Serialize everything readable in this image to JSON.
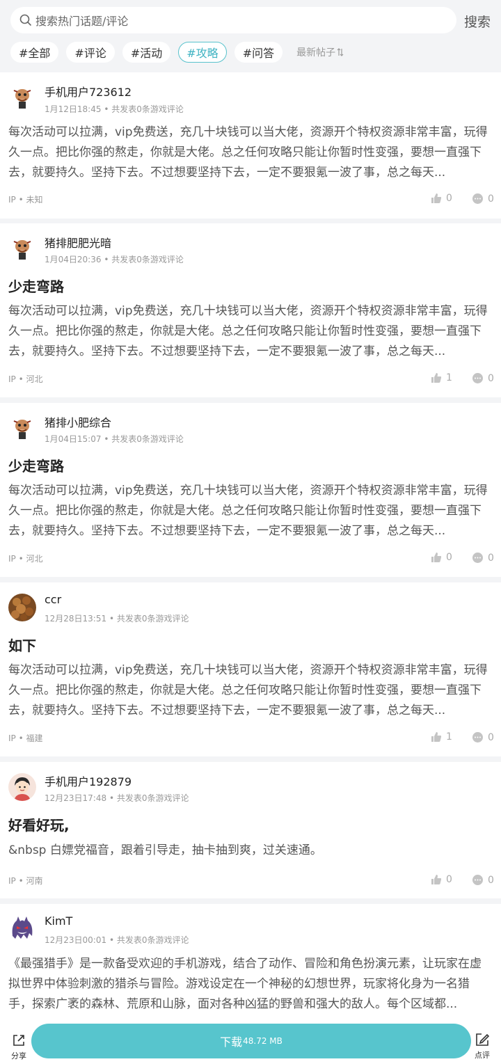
{
  "search": {
    "placeholder": "搜索热门话题/评论",
    "button": "搜索"
  },
  "tabs": [
    {
      "label": "#全部",
      "active": false
    },
    {
      "label": "#评论",
      "active": false
    },
    {
      "label": "#活动",
      "active": false
    },
    {
      "label": "#攻略",
      "active": true
    },
    {
      "label": "#问答",
      "active": false
    }
  ],
  "sort_label": "最新帖子",
  "accent_color": "#57c5cd",
  "posts": [
    {
      "user": "手机用户723612",
      "date": "1月12日18:45",
      "meta_suffix": " • 共发表0条游戏评论",
      "title": "",
      "body": "每次活动可以拉满，vip免费送，充几十块钱可以当大佬，资源开个特权资源非常丰富，玩得久一点。把比你强的熬走，你就是大佬。总之任何攻略只能让你暂时性变强，要想一直强下去，就要持久。坚持下去。不过想要坚持下去，一定不要狠氪一波了事，总之每天...",
      "ip": "IP • 未知",
      "likes": "0",
      "comments": "0",
      "avatar": "cartoon-character-icon"
    },
    {
      "user": "猪排肥肥光暗",
      "date": "1月04日20:36",
      "meta_suffix": " • 共发表0条游戏评论",
      "title": "少走弯路",
      "body": "每次活动可以拉满，vip免费送，充几十块钱可以当大佬，资源开个特权资源非常丰富，玩得久一点。把比你强的熬走，你就是大佬。总之任何攻略只能让你暂时性变强，要想一直强下去，就要持久。坚持下去。不过想要坚持下去，一定不要狠氪一波了事，总之每天...",
      "ip": "IP • 河北",
      "likes": "1",
      "comments": "0",
      "avatar": "cartoon-character-icon"
    },
    {
      "user": "猪排小肥综合",
      "date": "1月04日15:07",
      "meta_suffix": " • 共发表0条游戏评论",
      "title": "少走弯路",
      "body": "每次活动可以拉满，vip免费送，充几十块钱可以当大佬，资源开个特权资源非常丰富，玩得久一点。把比你强的熬走，你就是大佬。总之任何攻略只能让你暂时性变强，要想一直强下去，就要持久。坚持下去。不过想要坚持下去，一定不要狠氪一波了事，总之每天...",
      "ip": "IP • 河北",
      "likes": "0",
      "comments": "0",
      "avatar": "cartoon-character-icon"
    },
    {
      "user": "ccr",
      "date": "12月28日13:51",
      "meta_suffix": " • 共发表0条游戏评论",
      "title": "如下",
      "body": "每次活动可以拉满，vip免费送，充几十块钱可以当大佬，资源开个特权资源非常丰富，玩得久一点。把比你强的熬走，你就是大佬。总之任何攻略只能让你暂时性变强，要想一直强下去，就要持久。坚持下去。不过想要坚持下去，一定不要狠氪一波了事，总之每天...",
      "ip": "IP • 福建",
      "likes": "1",
      "comments": "0",
      "avatar": "food-photo-avatar"
    },
    {
      "user": "手机用户192879",
      "date": "12月23日17:48",
      "meta_suffix": " • 共发表0条游戏评论",
      "title": "好看好玩,",
      "body": "&nbsp 白嫖党福音，跟着引导走，抽卡抽到爽，过关速通。",
      "ip": "IP • 河南",
      "likes": "0",
      "comments": "0",
      "avatar": "cartoon-boy-avatar"
    },
    {
      "user": "KimT",
      "date": "12月23日00:01",
      "meta_suffix": " • 共发表0条游戏评论",
      "title": "",
      "body": "《最强猎手》是一款备受欢迎的手机游戏，结合了动作、冒险和角色扮演元素，让玩家在虚拟世界中体验刺激的猎杀与冒险。游戏设定在一个神秘的幻想世界，玩家将化身为一名猎手，探索广袤的森林、荒原和山脉，面对各种凶猛的野兽和强大的敌人。每个区域都...",
      "ip": "",
      "likes": "",
      "comments": "",
      "avatar": "ghost-monster-avatar"
    }
  ],
  "bottom": {
    "share": "分享",
    "download": "下载",
    "download_size": "48.72 MB",
    "review": "点评"
  }
}
